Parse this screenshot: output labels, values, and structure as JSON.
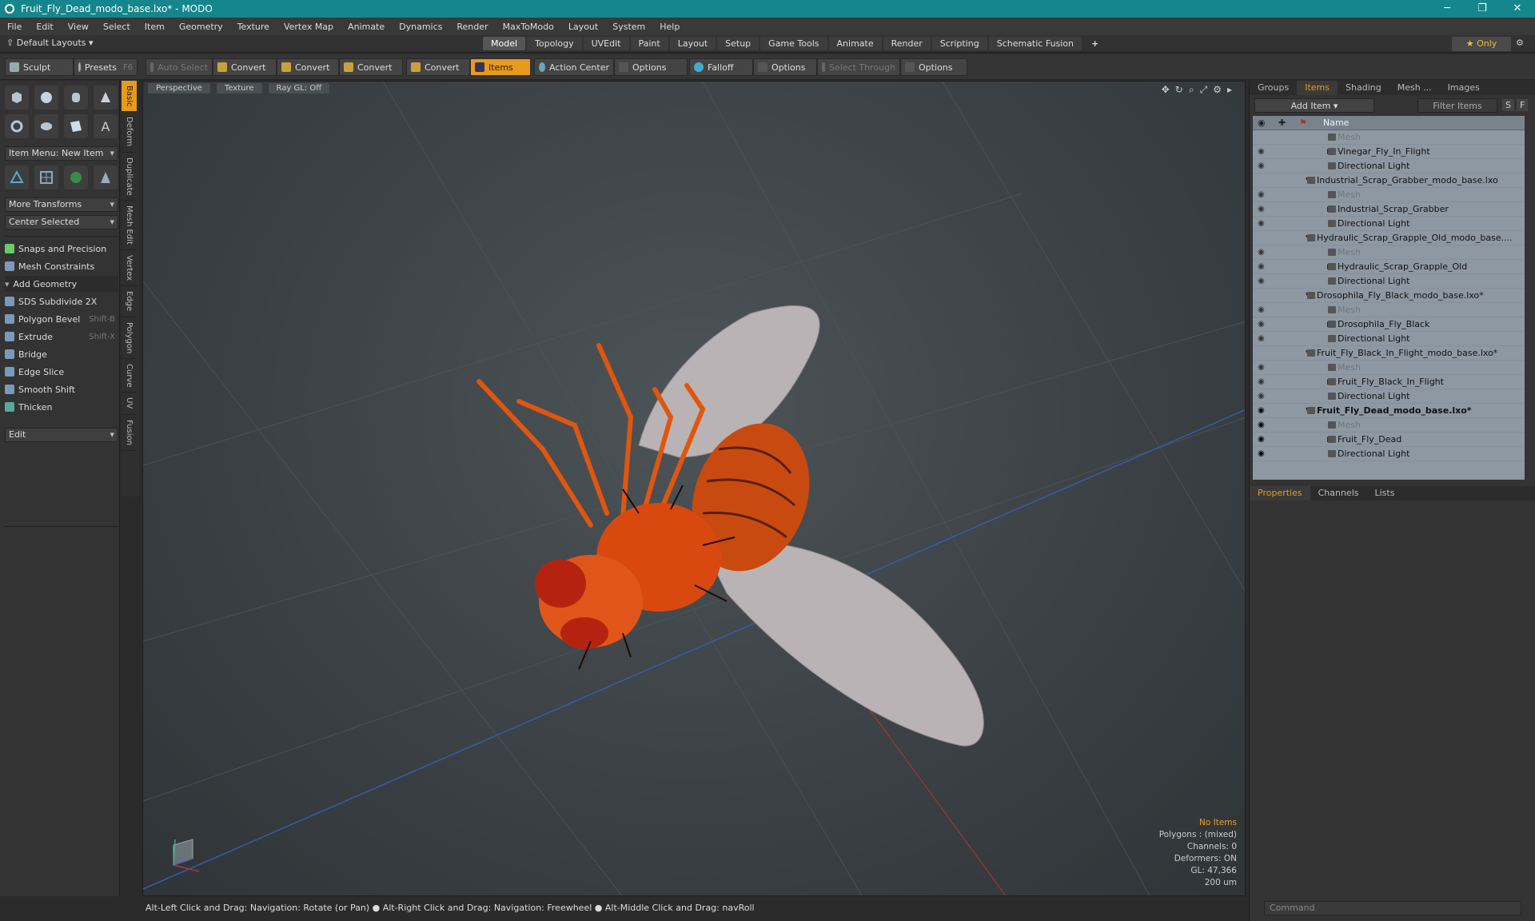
{
  "window": {
    "title": "Fruit_Fly_Dead_modo_base.lxo* - MODO",
    "min": "─",
    "max": "❐",
    "close": "✕"
  },
  "menu": [
    "File",
    "Edit",
    "View",
    "Select",
    "Item",
    "Geometry",
    "Texture",
    "Vertex Map",
    "Animate",
    "Dynamics",
    "Render",
    "MaxToModo",
    "Layout",
    "System",
    "Help"
  ],
  "layout": {
    "default_layouts": "Default Layouts",
    "tabs": [
      "Model",
      "Topology",
      "UVEdit",
      "Paint",
      "Layout",
      "Setup",
      "Game Tools",
      "Animate",
      "Render",
      "Scripting",
      "Schematic Fusion"
    ],
    "active_tab": "Model",
    "add": "+",
    "only": "★ Only"
  },
  "toolbar": {
    "sculpt": "Sculpt",
    "presets": "Presets",
    "presets_key": "F6",
    "auto_select": "Auto Select",
    "convert1": "Convert",
    "convert2": "Convert",
    "convert3": "Convert",
    "convert4": "Convert",
    "items": "Items",
    "action_center": "Action Center",
    "options1": "Options",
    "falloff": "Falloff",
    "options2": "Options",
    "select_through": "Select Through",
    "options3": "Options"
  },
  "left": {
    "vtabs": [
      "Basic",
      "Deform",
      "Duplicate",
      "Mesh Edit",
      "Vertex",
      "Edge",
      "Polygon",
      "Curve",
      "UV",
      "Fusion"
    ],
    "item_menu": "Item Menu: New Item",
    "more_transforms": "More Transforms",
    "center_selected": "Center Selected",
    "snaps": "Snaps and Precision",
    "mesh_constraints": "Mesh Constraints",
    "add_geometry": "Add Geometry",
    "tools": [
      {
        "label": "SDS Subdivide 2X",
        "key": ""
      },
      {
        "label": "Polygon Bevel",
        "key": "Shift-B"
      },
      {
        "label": "Extrude",
        "key": "Shift-X"
      },
      {
        "label": "Bridge",
        "key": ""
      },
      {
        "label": "Edge Slice",
        "key": ""
      },
      {
        "label": "Smooth Shift",
        "key": ""
      },
      {
        "label": "Thicken",
        "key": ""
      }
    ],
    "edit": "Edit"
  },
  "viewport": {
    "perspective": "Perspective",
    "texture": "Texture",
    "raygl": "Ray GL: Off",
    "info": {
      "no_items": "No Items",
      "polygons": "Polygons : (mixed)",
      "channels": "Channels: 0",
      "deformers": "Deformers: ON",
      "gl": "GL: 47,366",
      "scale": "200 um"
    },
    "colors": {
      "body": "#d9480f",
      "wing": "#b9b3b5",
      "grid_x": "#c0392b",
      "grid_z": "#3a5aa8"
    }
  },
  "status": "Alt-Left Click and Drag: Navigation: Rotate (or Pan) ● Alt-Right Click and Drag: Navigation: Freewheel ● Alt-Middle Click and Drag: navRoll",
  "right": {
    "tabs": [
      "Groups",
      "Items",
      "Shading",
      "Mesh ...",
      "Images"
    ],
    "active_tab": "Items",
    "add_item": "Add Item",
    "filter_items": "Filter Items",
    "filter_s": "S",
    "filter_f": "F",
    "name_header": "Name",
    "tree": [
      {
        "label": "Mesh",
        "indent": 2,
        "kind": "mesh",
        "eye": false
      },
      {
        "label": "Vinegar_Fly_In_Flight",
        "indent": 2,
        "kind": "item",
        "eye": true,
        "arrow": "▶"
      },
      {
        "label": "Directional Light",
        "indent": 2,
        "kind": "light",
        "eye": true
      },
      {
        "label": "Industrial_Scrap_Grabber_modo_base.lxo",
        "indent": 1,
        "kind": "scene",
        "eye": false,
        "arrow": "▼"
      },
      {
        "label": "Mesh",
        "indent": 2,
        "kind": "mesh",
        "eye": true
      },
      {
        "label": "Industrial_Scrap_Grabber",
        "indent": 2,
        "kind": "item",
        "eye": true,
        "arrow": "▶"
      },
      {
        "label": "Directional Light",
        "indent": 2,
        "kind": "light",
        "eye": true
      },
      {
        "label": "Hydraulic_Scrap_Grapple_Old_modo_base....",
        "indent": 1,
        "kind": "scene",
        "eye": false,
        "arrow": "▼"
      },
      {
        "label": "Mesh",
        "indent": 2,
        "kind": "mesh",
        "eye": true
      },
      {
        "label": "Hydraulic_Scrap_Grapple_Old",
        "indent": 2,
        "kind": "item",
        "eye": true,
        "arrow": "▶"
      },
      {
        "label": "Directional Light",
        "indent": 2,
        "kind": "light",
        "eye": true
      },
      {
        "label": "Drosophila_Fly_Black_modo_base.lxo*",
        "indent": 1,
        "kind": "scene",
        "eye": false,
        "arrow": "▼"
      },
      {
        "label": "Mesh",
        "indent": 2,
        "kind": "mesh",
        "eye": true
      },
      {
        "label": "Drosophila_Fly_Black",
        "indent": 2,
        "kind": "item",
        "eye": true,
        "arrow": "▶"
      },
      {
        "label": "Directional Light",
        "indent": 2,
        "kind": "light",
        "eye": true
      },
      {
        "label": "Fruit_Fly_Black_In_Flight_modo_base.lxo*",
        "indent": 1,
        "kind": "scene",
        "eye": false,
        "arrow": "▼"
      },
      {
        "label": "Mesh",
        "indent": 2,
        "kind": "mesh",
        "eye": true
      },
      {
        "label": "Fruit_Fly_Black_In_Flight",
        "indent": 2,
        "kind": "item",
        "eye": true,
        "arrow": "▶"
      },
      {
        "label": "Directional Light",
        "indent": 2,
        "kind": "light",
        "eye": true
      },
      {
        "label": "Fruit_Fly_Dead_modo_base.lxo*",
        "indent": 1,
        "kind": "scene",
        "eye": true,
        "arrow": "▼",
        "bold": true
      },
      {
        "label": "Mesh",
        "indent": 2,
        "kind": "mesh",
        "eye": true
      },
      {
        "label": "Fruit_Fly_Dead",
        "indent": 2,
        "kind": "item",
        "eye": true,
        "arrow": "▶"
      },
      {
        "label": "Directional Light",
        "indent": 2,
        "kind": "light",
        "eye": true
      }
    ],
    "props_tabs": [
      "Properties",
      "Channels",
      "Lists"
    ],
    "props_active": "Properties",
    "command_placeholder": "Command"
  }
}
